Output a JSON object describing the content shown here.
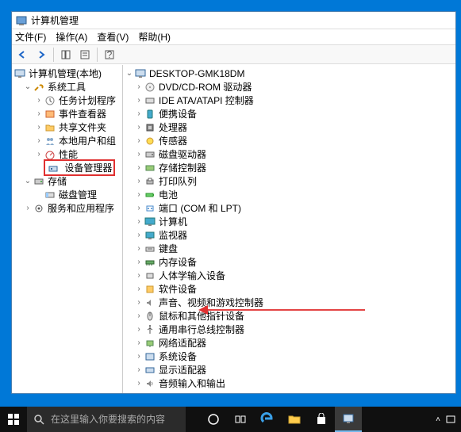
{
  "titlebar": {
    "title": "计算机管理"
  },
  "menubar": {
    "file": "文件(F)",
    "action": "操作(A)",
    "view": "查看(V)",
    "help": "帮助(H)"
  },
  "left": {
    "root": "计算机管理(本地)",
    "systools": "系统工具",
    "task": "任务计划程序",
    "event": "事件查看器",
    "shared": "共享文件夹",
    "users": "本地用户和组",
    "perf": "性能",
    "devmgr": "设备管理器",
    "storage": "存储",
    "disk": "磁盘管理",
    "services": "服务和应用程序"
  },
  "right": {
    "host": "DESKTOP-GMK18DM",
    "items": {
      "dvd": "DVD/CD-ROM 驱动器",
      "ide": "IDE ATA/ATAPI 控制器",
      "portable": "便携设备",
      "cpu": "处理器",
      "sensor": "传感器",
      "diskdrive": "磁盘驱动器",
      "storagectrl": "存储控制器",
      "printqueue": "打印队列",
      "battery": "电池",
      "ports": "端口 (COM 和 LPT)",
      "computer": "计算机",
      "monitor": "监视器",
      "keyboard": "键盘",
      "memory": "内存设备",
      "hid": "人体学输入设备",
      "software": "软件设备",
      "sound": "声音、视频和游戏控制器",
      "mouse": "鼠标和其他指针设备",
      "usb": "通用串行总线控制器",
      "network": "网络适配器",
      "system": "系统设备",
      "display": "显示适配器",
      "audio": "音频输入和输出"
    }
  },
  "taskbar": {
    "search_placeholder": "在这里输入你要搜索的内容"
  }
}
